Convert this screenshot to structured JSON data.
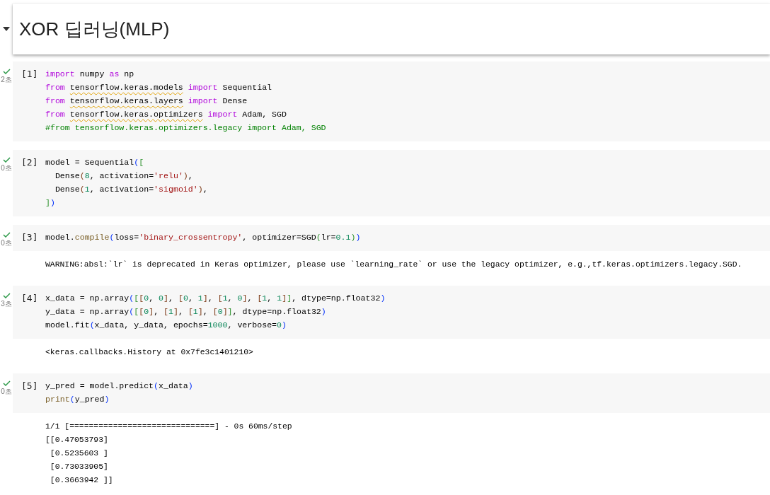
{
  "heading": {
    "title": "XOR 딥러닝(MLP)",
    "expanded": true
  },
  "cells": [
    {
      "count": "[1]",
      "time": "2초",
      "done": true,
      "code": [
        [
          {
            "t": "import",
            "kind": "kw"
          },
          {
            "t": " numpy ",
            "kind": "p"
          },
          {
            "t": "as",
            "kind": "kw"
          },
          {
            "t": " np",
            "kind": "p"
          }
        ],
        [
          {
            "t": "from ",
            "kind": "kw"
          },
          {
            "t": "tensorflow.keras.models",
            "kind": "mod"
          },
          {
            "t": " import",
            "kind": "kw"
          },
          {
            "t": " Sequential",
            "kind": "p"
          }
        ],
        [
          {
            "t": "from ",
            "kind": "kw"
          },
          {
            "t": "tensorflow.keras.layers",
            "kind": "mod"
          },
          {
            "t": " import",
            "kind": "kw"
          },
          {
            "t": " Dense",
            "kind": "p"
          }
        ],
        [
          {
            "t": "from ",
            "kind": "kw"
          },
          {
            "t": "tensorflow.keras.optimizers",
            "kind": "mod"
          },
          {
            "t": " import",
            "kind": "kw"
          },
          {
            "t": " Adam, SGD",
            "kind": "p"
          }
        ],
        [
          {
            "t": "#from tensorflow.keras.optimizers.legacy import Adam, SGD",
            "kind": "cm"
          }
        ]
      ]
    },
    {
      "count": "[2]",
      "time": "0초",
      "done": true,
      "code": [
        [
          {
            "t": "model = Sequential",
            "kind": "p"
          },
          {
            "t": "(",
            "kind": "b1"
          },
          {
            "t": "[",
            "kind": "b2"
          }
        ],
        [
          {
            "t": "  Dense",
            "kind": "p"
          },
          {
            "t": "(",
            "kind": "b3"
          },
          {
            "t": "8",
            "kind": "num"
          },
          {
            "t": ", activation=",
            "kind": "p"
          },
          {
            "t": "'relu'",
            "kind": "str"
          },
          {
            "t": ")",
            "kind": "b3"
          },
          {
            "t": ",",
            "kind": "p"
          }
        ],
        [
          {
            "t": "  Dense",
            "kind": "p"
          },
          {
            "t": "(",
            "kind": "b3"
          },
          {
            "t": "1",
            "kind": "num"
          },
          {
            "t": ", activation=",
            "kind": "p"
          },
          {
            "t": "'sigmoid'",
            "kind": "str"
          },
          {
            "t": ")",
            "kind": "b3"
          },
          {
            "t": ",",
            "kind": "p"
          }
        ],
        [
          {
            "t": "]",
            "kind": "b2"
          },
          {
            "t": ")",
            "kind": "b1"
          }
        ]
      ]
    },
    {
      "count": "[3]",
      "time": "0초",
      "done": true,
      "code": [
        [
          {
            "t": "model.",
            "kind": "p"
          },
          {
            "t": "compile",
            "kind": "fn"
          },
          {
            "t": "(",
            "kind": "b1"
          },
          {
            "t": "loss=",
            "kind": "p"
          },
          {
            "t": "'binary_crossentropy'",
            "kind": "str"
          },
          {
            "t": ", optimizer=SGD",
            "kind": "p"
          },
          {
            "t": "(",
            "kind": "b2"
          },
          {
            "t": "lr=",
            "kind": "p"
          },
          {
            "t": "0.1",
            "kind": "num"
          },
          {
            "t": ")",
            "kind": "b2"
          },
          {
            "t": ")",
            "kind": "b1"
          }
        ]
      ],
      "output": [
        "WARNING:absl:`lr` is deprecated in Keras optimizer, please use `learning_rate` or use the legacy optimizer, e.g.,tf.keras.optimizers.legacy.SGD."
      ]
    },
    {
      "count": "[4]",
      "time": "3초",
      "done": true,
      "code": [
        [
          {
            "t": "x_data = np.array",
            "kind": "p"
          },
          {
            "t": "(",
            "kind": "b1"
          },
          {
            "t": "[",
            "kind": "b2"
          },
          {
            "t": "[",
            "kind": "b3"
          },
          {
            "t": "0",
            "kind": "num"
          },
          {
            "t": ", ",
            "kind": "p"
          },
          {
            "t": "0",
            "kind": "num"
          },
          {
            "t": "]",
            "kind": "b3"
          },
          {
            "t": ", ",
            "kind": "p"
          },
          {
            "t": "[",
            "kind": "b3"
          },
          {
            "t": "0",
            "kind": "num"
          },
          {
            "t": ", ",
            "kind": "p"
          },
          {
            "t": "1",
            "kind": "num"
          },
          {
            "t": "]",
            "kind": "b3"
          },
          {
            "t": ", ",
            "kind": "p"
          },
          {
            "t": "[",
            "kind": "b3"
          },
          {
            "t": "1",
            "kind": "num"
          },
          {
            "t": ", ",
            "kind": "p"
          },
          {
            "t": "0",
            "kind": "num"
          },
          {
            "t": "]",
            "kind": "b3"
          },
          {
            "t": ", ",
            "kind": "p"
          },
          {
            "t": "[",
            "kind": "b3"
          },
          {
            "t": "1",
            "kind": "num"
          },
          {
            "t": ", ",
            "kind": "p"
          },
          {
            "t": "1",
            "kind": "num"
          },
          {
            "t": "]",
            "kind": "b3"
          },
          {
            "t": "]",
            "kind": "b2"
          },
          {
            "t": ", dtype=np.float32",
            "kind": "p"
          },
          {
            "t": ")",
            "kind": "b1"
          }
        ],
        [
          {
            "t": "y_data = np.array",
            "kind": "p"
          },
          {
            "t": "(",
            "kind": "b1"
          },
          {
            "t": "[",
            "kind": "b2"
          },
          {
            "t": "[",
            "kind": "b3"
          },
          {
            "t": "0",
            "kind": "num"
          },
          {
            "t": "]",
            "kind": "b3"
          },
          {
            "t": ", ",
            "kind": "p"
          },
          {
            "t": "[",
            "kind": "b3"
          },
          {
            "t": "1",
            "kind": "num"
          },
          {
            "t": "]",
            "kind": "b3"
          },
          {
            "t": ", ",
            "kind": "p"
          },
          {
            "t": "[",
            "kind": "b3"
          },
          {
            "t": "1",
            "kind": "num"
          },
          {
            "t": "]",
            "kind": "b3"
          },
          {
            "t": ", ",
            "kind": "p"
          },
          {
            "t": "[",
            "kind": "b3"
          },
          {
            "t": "0",
            "kind": "num"
          },
          {
            "t": "]",
            "kind": "b3"
          },
          {
            "t": "]",
            "kind": "b2"
          },
          {
            "t": ", dtype=np.float32",
            "kind": "p"
          },
          {
            "t": ")",
            "kind": "b1"
          }
        ],
        [
          {
            "t": "model.fit",
            "kind": "p"
          },
          {
            "t": "(",
            "kind": "b1"
          },
          {
            "t": "x_data, y_data, epochs=",
            "kind": "p"
          },
          {
            "t": "1000",
            "kind": "num"
          },
          {
            "t": ", verbose=",
            "kind": "p"
          },
          {
            "t": "0",
            "kind": "num"
          },
          {
            "t": ")",
            "kind": "b1"
          }
        ]
      ],
      "output": [
        "<keras.callbacks.History at 0x7fe3c1401210>"
      ]
    },
    {
      "count": "[5]",
      "time": "0초",
      "done": true,
      "code": [
        [
          {
            "t": "y_pred = model.predict",
            "kind": "p"
          },
          {
            "t": "(",
            "kind": "b1"
          },
          {
            "t": "x_data",
            "kind": "p"
          },
          {
            "t": ")",
            "kind": "b1"
          }
        ],
        [
          {
            "t": "print",
            "kind": "fn"
          },
          {
            "t": "(",
            "kind": "b1"
          },
          {
            "t": "y_pred",
            "kind": "p"
          },
          {
            "t": ")",
            "kind": "b1"
          }
        ]
      ],
      "output": [
        "1/1 [==============================] - 0s 60ms/step",
        "[[0.47053793]",
        " [0.5235603 ]",
        " [0.73033905]",
        " [0.3663942 ]]"
      ]
    }
  ]
}
